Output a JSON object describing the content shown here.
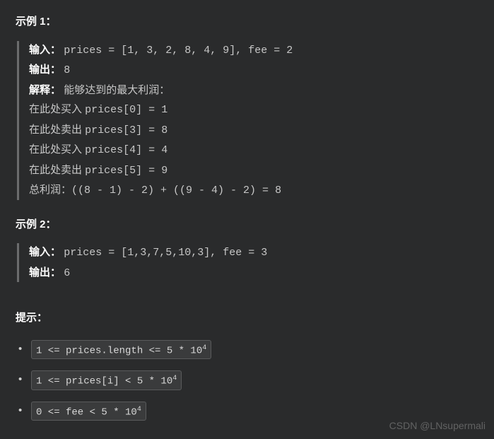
{
  "example1": {
    "title": "示例 1：",
    "input_label": "输入：",
    "input_value": "prices = [1, 3, 2, 8, 4, 9], fee = 2",
    "output_label": "输出：",
    "output_value": "8",
    "explain_label": "解释：",
    "explain_text": "能够达到的最大利润：",
    "steps": [
      {
        "cn": "在此处买入 ",
        "code": "prices[0] = 1"
      },
      {
        "cn": "在此处卖出 ",
        "code": "prices[3] = 8"
      },
      {
        "cn": "在此处买入 ",
        "code": "prices[4] = 4"
      },
      {
        "cn": "在此处卖出 ",
        "code": "prices[5] = 9"
      }
    ],
    "total_label_cn": "总利润：",
    "total_expr": "((8 - 1) - 2) + ((9 - 4) - 2) = 8"
  },
  "example2": {
    "title": "示例 2：",
    "input_label": "输入：",
    "input_value": "prices = [1,3,7,5,10,3], fee = 3",
    "output_label": "输出：",
    "output_value": "6"
  },
  "hints": {
    "title": "提示：",
    "items": [
      {
        "pre": "1 <= prices.length <= 5 * 10",
        "sup": "4"
      },
      {
        "pre": "1 <= prices[i] < 5 * 10",
        "sup": "4"
      },
      {
        "pre": "0 <= fee < 5 * 10",
        "sup": "4"
      }
    ]
  },
  "watermark": "CSDN @LNsupermali"
}
